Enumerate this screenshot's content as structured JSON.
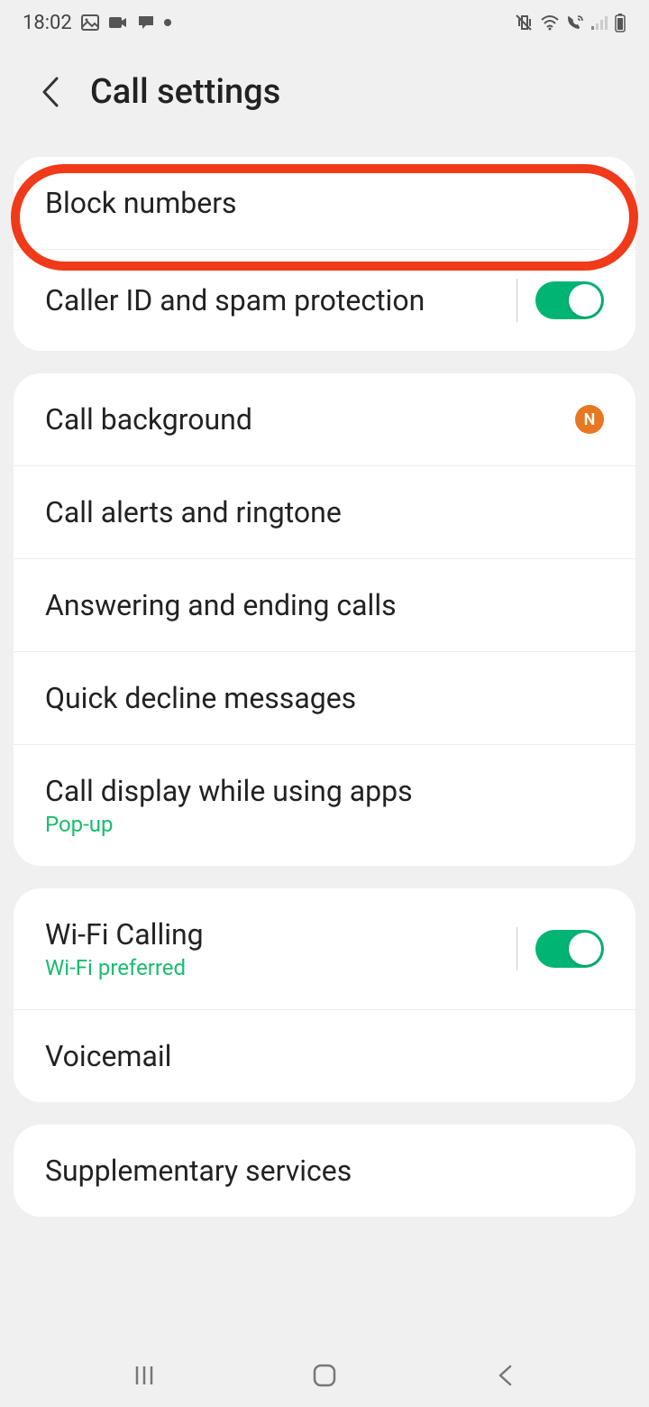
{
  "statusBar": {
    "time": "18:02"
  },
  "header": {
    "title": "Call settings"
  },
  "section1": {
    "blockNumbers": "Block numbers",
    "callerIdSpam": "Caller ID and spam protection"
  },
  "section2": {
    "callBackground": "Call background",
    "badgeN": "N",
    "callAlerts": "Call alerts and ringtone",
    "answering": "Answering and ending calls",
    "quickDecline": "Quick decline messages",
    "callDisplay": "Call display while using apps",
    "callDisplaySub": "Pop-up"
  },
  "section3": {
    "wifiCalling": "Wi-Fi Calling",
    "wifiCallingSub": "Wi-Fi preferred",
    "voicemail": "Voicemail"
  },
  "section4": {
    "supplementary": "Supplementary services"
  }
}
